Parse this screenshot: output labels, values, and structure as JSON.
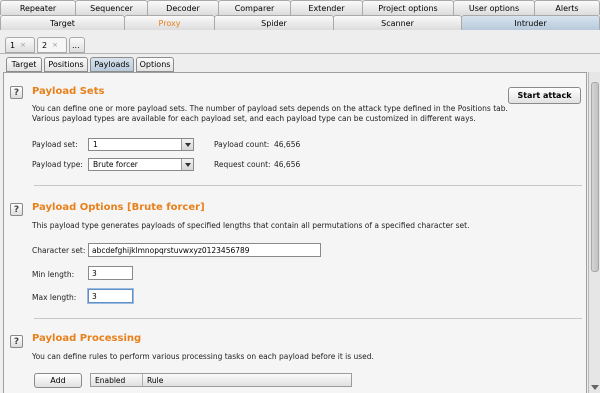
{
  "top_tabs_row1": [
    "Repeater",
    "Sequencer",
    "Decoder",
    "Comparer",
    "Extender",
    "Project options",
    "User options",
    "Alerts"
  ],
  "top_tabs_row2": [
    "Target",
    "Proxy",
    "Spider",
    "Scanner",
    "Intruder"
  ],
  "active_top_tab": "Intruder",
  "highlighted_top_tab": "Proxy",
  "attack_tabs": [
    {
      "label": "1",
      "close": "×"
    },
    {
      "label": "2",
      "close": "×"
    },
    {
      "label": "..."
    }
  ],
  "sub_tabs": [
    "Target",
    "Positions",
    "Payloads",
    "Options"
  ],
  "active_sub_tab": "Payloads",
  "payload_sets": {
    "title": "Payload Sets",
    "desc_line1": "You can define one or more payload sets. The number of payload sets depends on the attack type defined in the Positions tab.",
    "desc_line2": "Various payload types are available for each payload set, and each payload type can be customized in different ways.",
    "start_attack": "Start attack",
    "set_label": "Payload set:",
    "set_value": "1",
    "type_label": "Payload type:",
    "type_value": "Brute forcer",
    "count_label": "Payload count:",
    "count_value": "46,656",
    "request_label": "Request count:",
    "request_value": "46,656"
  },
  "payload_options": {
    "title": "Payload Options [Brute forcer]",
    "desc": "This payload type generates payloads of specified lengths that contain all permutations of a specified character set.",
    "charset_label": "Character set:",
    "charset_value": "abcdefghijklmnopqrstuvwxyz0123456789",
    "min_label": "Min length:",
    "min_value": "3",
    "max_label": "Max length:",
    "max_value": "3"
  },
  "payload_processing": {
    "title": "Payload Processing",
    "desc": "You can define rules to perform various processing tasks on each payload before it is used.",
    "add": "Add",
    "col_enabled": "Enabled",
    "col_rule": "Rule"
  },
  "help_glyph": "?",
  "colors": {
    "accent_orange": "#e8801b",
    "active_tab": "#b9cadc"
  }
}
